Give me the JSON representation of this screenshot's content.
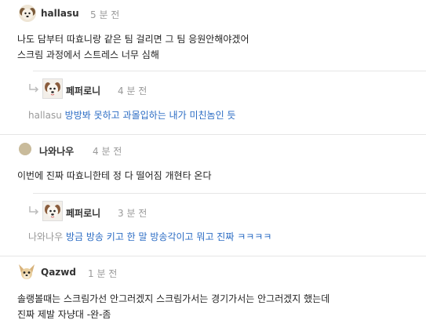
{
  "comments": [
    {
      "author": "hallasu",
      "time": "5 분 전",
      "lines": [
        "나도 담부터 따효니랑 같은 팀 걸리면 그 팀 응원안해야겠어",
        "스크림 과정에서 스트레스 너무 심해"
      ],
      "reply": {
        "author": "페퍼로니",
        "time": "4 분 전",
        "to": "hallasu",
        "text": "방방봐 못하고 과몰입하는 내가 미친놈인 듯"
      }
    },
    {
      "author": "나와나우",
      "time": "4 분 전",
      "lines": [
        "이번에 진짜 따효니한테 정 다 떨어짐 개현타 온다"
      ],
      "reply": {
        "author": "페퍼로니",
        "time": "3 분 전",
        "to": "나와나우",
        "text": "방금 방송 키고 한 말 방송각이고 뭐고 진짜 ㅋㅋㅋㅋ"
      }
    },
    {
      "author": "Qazwd",
      "time": "1 분 전",
      "lines": [
        "솔랭볼때는 스크림가선 안그러겠지 스크림가서는 경기가서는 안그러겠지 했는데",
        "진짜 제발 자냥대 -완-좀"
      ]
    }
  ],
  "icons": {
    "reply_arrow": "reply-arrow-icon",
    "puppy_avatar": "puppy-avatar",
    "dot_avatar": "dot-avatar",
    "chihuahua_avatar": "chihuahua-avatar"
  },
  "colors": {
    "reply_text": "#2b6cc4",
    "meta_text": "#999999",
    "divider": "#e6e6e6"
  }
}
